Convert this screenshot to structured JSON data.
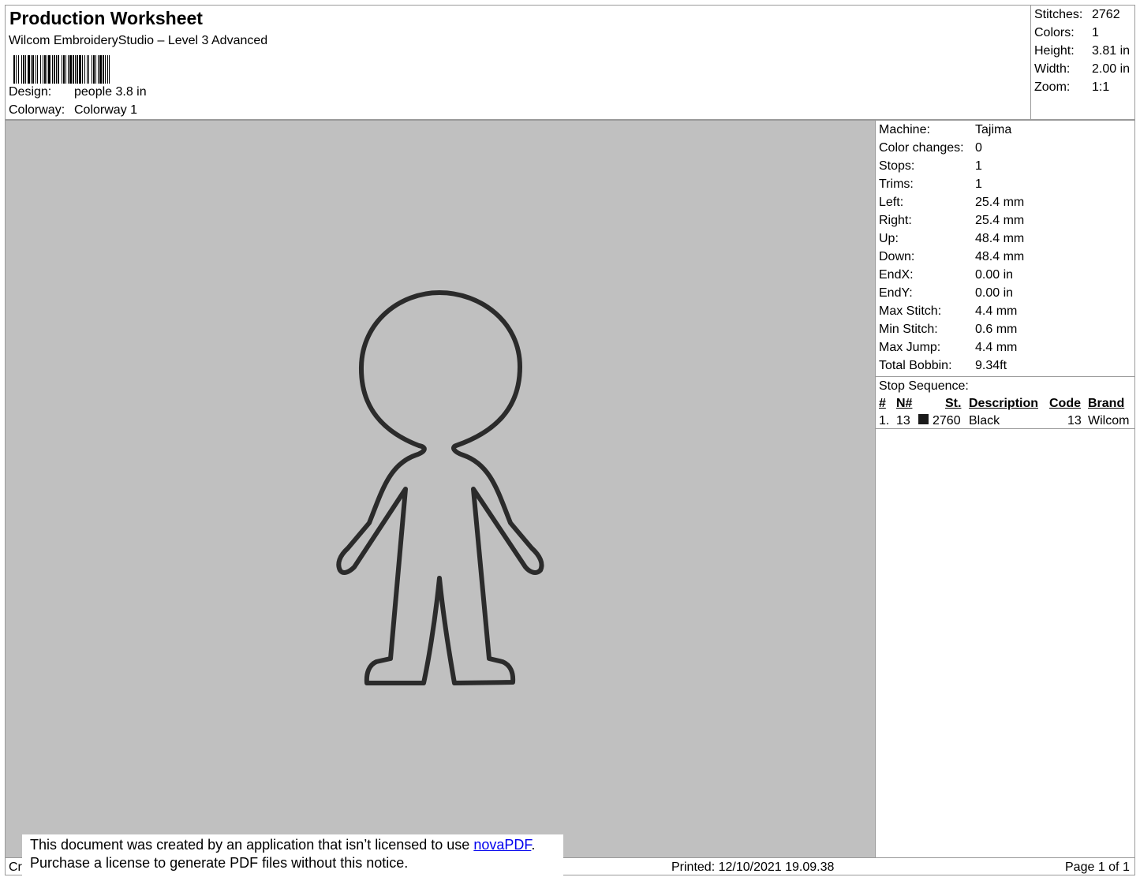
{
  "header": {
    "title": "Production Worksheet",
    "software": "Wilcom EmbroideryStudio – Level 3 Advanced",
    "barcode_bars": [
      2,
      1,
      1,
      2,
      1,
      3,
      1,
      1,
      2,
      1,
      1,
      2,
      3,
      1,
      1,
      1,
      2,
      2,
      1,
      1,
      1,
      3,
      1,
      2,
      1,
      1,
      2,
      1,
      1,
      1,
      3,
      2,
      1,
      1,
      2,
      1,
      1,
      1,
      2,
      3,
      1,
      1,
      2,
      1,
      1,
      2,
      1,
      1,
      3,
      1,
      2,
      1,
      1,
      1,
      2,
      1,
      3,
      1,
      1,
      2,
      1,
      2,
      1,
      1,
      1,
      3,
      1,
      1,
      2,
      1,
      1,
      2,
      1,
      1,
      3,
      1,
      2,
      1,
      1,
      2,
      1,
      1,
      1,
      2
    ],
    "design_label": "Design:",
    "design_value": "people 3.8 in",
    "colorway_label": "Colorway:",
    "colorway_value": "Colorway 1"
  },
  "summary": [
    {
      "label": "Stitches:",
      "value": "2762"
    },
    {
      "label": "Colors:",
      "value": "1"
    },
    {
      "label": "Height:",
      "value": "3.81 in"
    },
    {
      "label": "Width:",
      "value": "2.00 in"
    },
    {
      "label": "Zoom:",
      "value": "1:1"
    }
  ],
  "machine_info": [
    {
      "label": "Machine:",
      "value": "Tajima"
    },
    {
      "label": "Color changes:",
      "value": "0"
    },
    {
      "label": "Stops:",
      "value": "1"
    },
    {
      "label": "Trims:",
      "value": "1"
    },
    {
      "label": "Left:",
      "value": "25.4 mm"
    },
    {
      "label": "Right:",
      "value": "25.4 mm"
    },
    {
      "label": "Up:",
      "value": "48.4 mm"
    },
    {
      "label": "Down:",
      "value": "48.4 mm"
    },
    {
      "label": "EndX:",
      "value": "0.00 in"
    },
    {
      "label": "EndY:",
      "value": "0.00 in"
    },
    {
      "label": "Max Stitch:",
      "value": "4.4 mm"
    },
    {
      "label": "Min Stitch:",
      "value": "0.6 mm"
    },
    {
      "label": "Max Jump:",
      "value": "4.4 mm"
    },
    {
      "label": "Total Bobbin:",
      "value": "9.34ft"
    }
  ],
  "stop_sequence": {
    "title": "Stop Sequence:",
    "headers": {
      "index": "#",
      "needle": "N#",
      "stitches": "St.",
      "description": "Description",
      "code": "Code",
      "brand": "Brand"
    },
    "rows": [
      {
        "index": "1.",
        "needle": "13",
        "swatch_color": "#1a1a1a",
        "stitches": "2760",
        "description": "Black",
        "code": "13",
        "brand": "Wilcom"
      }
    ]
  },
  "preview": {
    "background": "#c0c0c0",
    "outline_color": "#333333"
  },
  "footer": {
    "created_prefix": "Cr",
    "notice_line1": "This document was created by an application that isn’t licensed to use ",
    "notice_link": "novaPDF",
    "notice_line1_end": ".",
    "notice_line2": "Purchase a license to generate PDF files without this notice.",
    "printed": "Printed: 12/10/2021 19.09.38",
    "page": "Page 1 of 1"
  }
}
